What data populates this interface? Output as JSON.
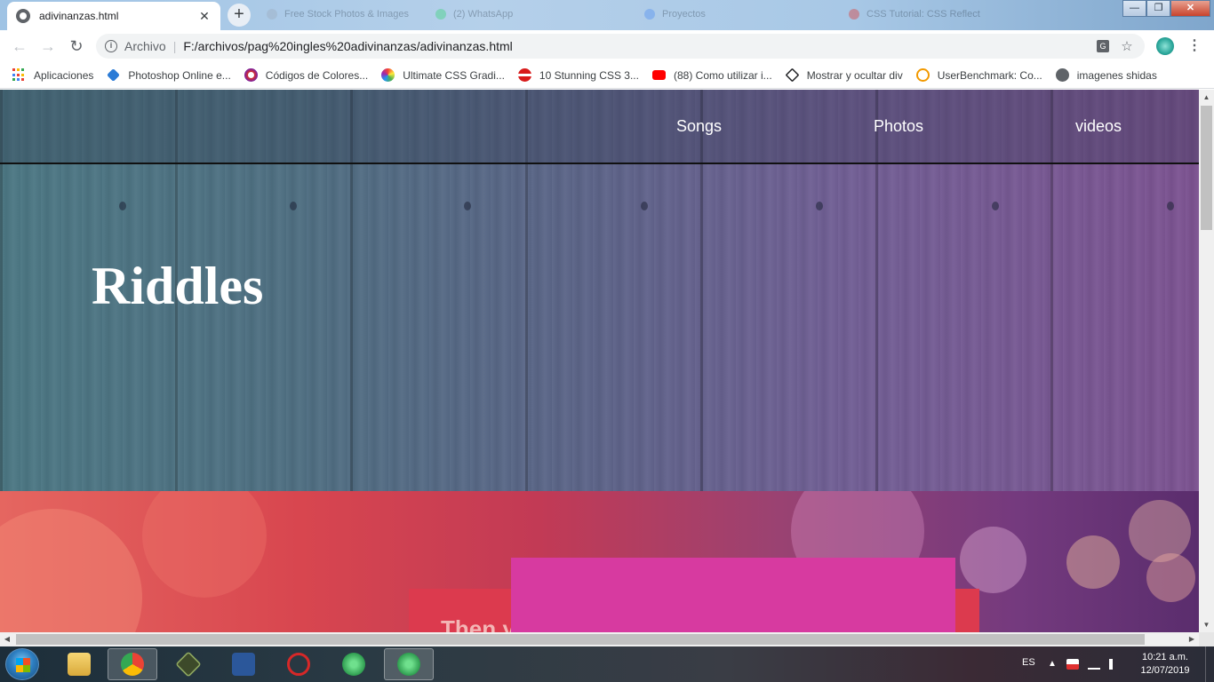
{
  "browser": {
    "active_tab": {
      "title": "adivinanzas.html",
      "close": "✕"
    },
    "new_tab": "+",
    "background_tabs": [
      {
        "label": "Free Stock Photos & Images",
        "color": "#9aa7b8"
      },
      {
        "label": "(2) WhatsApp",
        "color": "#25d366"
      },
      {
        "label": "Proyectos",
        "color": "#4285f4"
      },
      {
        "label": "CSS Tutorial: CSS Reflect",
        "color": "#e62117"
      }
    ],
    "window_controls": {
      "minimize": "—",
      "maximize": "❐",
      "close": "✕"
    },
    "nav": {
      "back": "←",
      "forward": "→",
      "reload": "↻"
    },
    "omnibox": {
      "info_icon": "i",
      "scheme": "Archivo",
      "separator": "|",
      "url": "F:/archivos/pag%20ingles%20adivinanzas/adivinanzas.html",
      "translate_icon": "G",
      "star_icon": "☆"
    },
    "menu": "⋮",
    "bookmarks": [
      {
        "label": "Aplicaciones",
        "icon": "apps-grid-icon"
      },
      {
        "label": "Photoshop Online e...",
        "icon": "photoshop-icon",
        "color": "#2b7bd6"
      },
      {
        "label": "Códigos de Colores...",
        "icon": "color-codes-icon",
        "color": "#d42f2f"
      },
      {
        "label": "Ultimate CSS Gradi...",
        "icon": "gradient-icon",
        "color": "#9c27b0"
      },
      {
        "label": "10 Stunning CSS 3...",
        "icon": "no-entry-icon",
        "color": "#d81b1b"
      },
      {
        "label": "(88) Como utilizar i...",
        "icon": "youtube-icon",
        "color": "#ff0000"
      },
      {
        "label": "Mostrar y ocultar div",
        "icon": "codepen-icon",
        "color": "#202124"
      },
      {
        "label": "UserBenchmark: Co...",
        "icon": "userbenchmark-icon",
        "color": "#f29900"
      },
      {
        "label": "imagenes shidas",
        "icon": "globe-icon",
        "color": "#5f6368"
      }
    ]
  },
  "page": {
    "nav": {
      "songs": "Songs",
      "photos": "Photos",
      "videos": "videos"
    },
    "hero_title": "Riddles",
    "card_text": "Then y"
  },
  "taskbar": {
    "lang": "ES",
    "tray_arrow": "▲",
    "clock_time": "10:21 a.m.",
    "clock_date": "12/07/2019"
  }
}
